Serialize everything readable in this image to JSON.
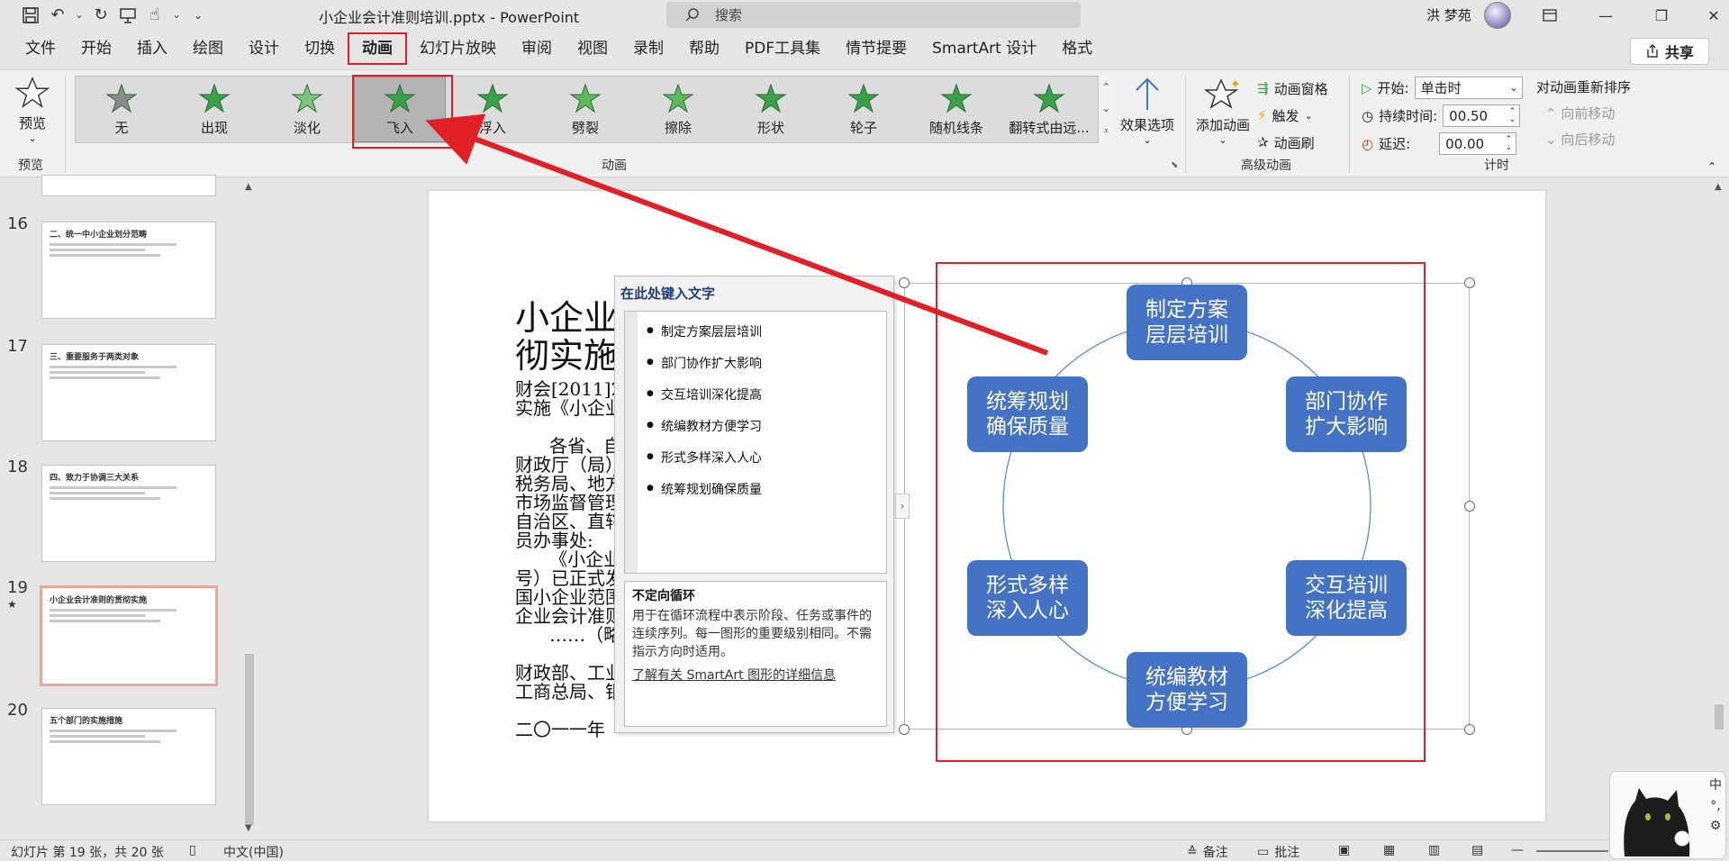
{
  "window": {
    "title": "小企业会计准则培训.pptx  -  PowerPoint",
    "search_placeholder": "搜索",
    "user_name": "洪 梦苑"
  },
  "tabs": [
    "文件",
    "开始",
    "插入",
    "绘图",
    "设计",
    "切换",
    "动画",
    "幻灯片放映",
    "审阅",
    "视图",
    "录制",
    "帮助",
    "PDF工具集",
    "情节提要",
    "SmartArt 设计",
    "格式"
  ],
  "active_tab": "动画",
  "share_label": "共享",
  "ribbon": {
    "preview_label": "预览",
    "preview_group": "预览",
    "animation_group": "动画",
    "animations": [
      {
        "label": "无",
        "color": "#8a8a8a"
      },
      {
        "label": "出现",
        "color": "#3aa04a"
      },
      {
        "label": "淡化",
        "color": "#7cc47f"
      },
      {
        "label": "飞入",
        "color": "#3aa04a"
      },
      {
        "label": "浮入",
        "color": "#3aa04a"
      },
      {
        "label": "劈裂",
        "color": "#5fb85f"
      },
      {
        "label": "擦除",
        "color": "#5fb85f"
      },
      {
        "label": "形状",
        "color": "#3aa04a"
      },
      {
        "label": "轮子",
        "color": "#3aa04a"
      },
      {
        "label": "随机线条",
        "color": "#3aa04a"
      },
      {
        "label": "翻转式由远...",
        "color": "#3aa04a"
      }
    ],
    "selected_animation": "飞入",
    "effect_options": "效果选项",
    "advanced_group": "高级动画",
    "add_animation": "添加动画",
    "animation_pane": "动画窗格",
    "trigger": "触发",
    "animation_painter": "动画刷",
    "timing_group": "计时",
    "start_label": "开始:",
    "start_value": "单击时",
    "duration_label": "持续时间:",
    "duration_value": "00.50",
    "delay_label": "延迟:",
    "delay_value": "00.00",
    "reorder_label": "对动画重新排序",
    "move_earlier": "向前移动",
    "move_later": "向后移动"
  },
  "thumbnails": [
    {
      "num": "16",
      "title": "二、统一中小企业划分范畴"
    },
    {
      "num": "17",
      "title": "三、重要服务于两类对象"
    },
    {
      "num": "18",
      "title": "四、致力于协调三大关系"
    },
    {
      "num": "19",
      "title": "小企业会计准则的贯彻实施",
      "star": "★"
    },
    {
      "num": "20",
      "title": "五个部门的实施措施"
    }
  ],
  "slide": {
    "title_lines": "小企业\n彻实施",
    "body_lines": "财会[2011]2\n实施《小企业\n\n      各省、自\n财政厅（局）\n税务局、地方\n市场监督管理\n自治区、直辖\n员办事处:\n      《小企业\n号）已正式发\n国小企业范围\n企业会计准则\n      ……（略\n\n财政部、工业\n工商总局、银\n\n二〇一一年"
  },
  "text_pane": {
    "header": "在此处键入文字",
    "items": [
      "制定方案层层培训",
      "部门协作扩大影响",
      "交互培训深化提高",
      "统编教材方便学习",
      "形式多样深入人心",
      "统筹规划确保质量"
    ],
    "layout_name": "不定向循环",
    "layout_desc": "用于在循环流程中表示阶段、任务或事件的连续序列。每一图形的重要级别相同。不需指示方向时适用。",
    "learn_more": "了解有关 SmartArt 图形的详细信息"
  },
  "smartart": {
    "nodes": [
      "制定方案\n层层培训",
      "部门协作\n扩大影响",
      "交互培训\n深化提高",
      "统编教材\n方便学习",
      "形式多样\n深入人心",
      "统筹规划\n确保质量"
    ],
    "node_color": "#4472c4"
  },
  "status": {
    "slide_info": "幻灯片 第 19 张，共 20 张",
    "language": "中文(中国)",
    "notes": "备注",
    "comments": "批注"
  },
  "ime": {
    "mode": "中",
    "punct": "°,"
  },
  "colors": {
    "highlight_red": "#e01f26",
    "ribbon_bg": "#f0f0f0"
  }
}
